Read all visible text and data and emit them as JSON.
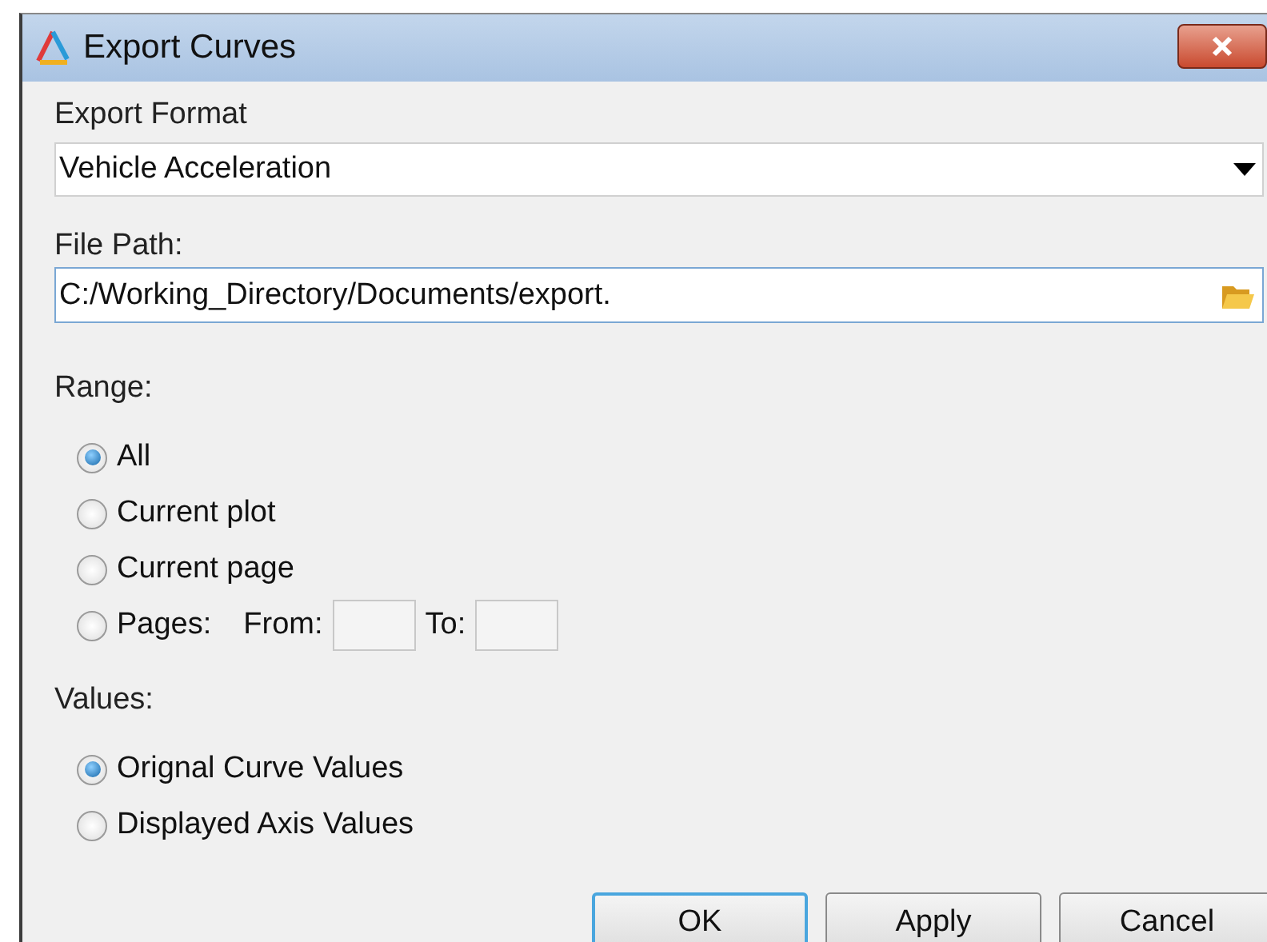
{
  "window": {
    "title": "Export Curves"
  },
  "export_format": {
    "label": "Export Format",
    "value": "Vehicle Acceleration"
  },
  "file_path": {
    "label": "File Path:",
    "value": "C:/Working_Directory/Documents/export."
  },
  "range": {
    "label": "Range:",
    "options": [
      {
        "kind": "plain",
        "label": "All",
        "selected": true
      },
      {
        "kind": "plain",
        "label": "Current plot",
        "selected": false
      },
      {
        "kind": "plain",
        "label": "Current page",
        "selected": false
      },
      {
        "kind": "pages",
        "label": "Pages:",
        "from_label": "From:",
        "to_label": "To:",
        "selected": false
      }
    ]
  },
  "values": {
    "label": "Values:",
    "options": [
      {
        "kind": "plain",
        "label": "Orignal Curve Values",
        "selected": true
      },
      {
        "kind": "plain",
        "label": "Displayed Axis Values",
        "selected": false
      }
    ]
  },
  "buttons": [
    {
      "label": "OK",
      "default": true
    },
    {
      "label": "Apply",
      "default": false
    },
    {
      "label": "Cancel",
      "default": false
    }
  ]
}
